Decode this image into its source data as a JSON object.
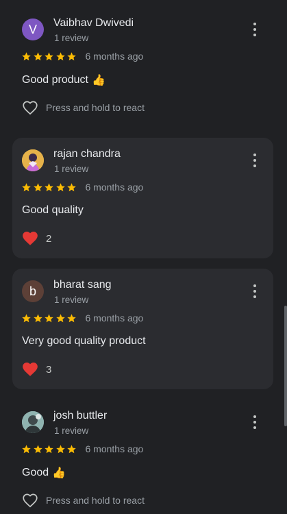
{
  "reviews": [
    {
      "reviewer": "Vaibhav Dwivedi",
      "avatar_letter": "V",
      "avatar_color": "#7e57c2",
      "review_count": "1 review",
      "rating": 5,
      "time": "6 months ago",
      "text": "Good product",
      "emoji": "👍",
      "reaction": "Press and hold to react",
      "liked": false
    },
    {
      "reviewer": "rajan chandra",
      "avatar_color": "#e6b24a",
      "review_count": "1 review",
      "rating": 5,
      "time": "6 months ago",
      "text": "Good quality",
      "emoji": "",
      "reaction_count": "2",
      "liked": true
    },
    {
      "reviewer": "bharat sang",
      "avatar_letter": "b",
      "avatar_color": "#5d4037",
      "review_count": "1 review",
      "rating": 5,
      "time": "6 months ago",
      "text": "Very good quality product",
      "emoji": "",
      "reaction_count": "3",
      "liked": true
    },
    {
      "reviewer": "josh buttler",
      "avatar_color": "#8fb3b0",
      "review_count": "1 review",
      "rating": 5,
      "time": "6 months ago",
      "text": "Good",
      "emoji": "👍",
      "reaction": "Press and hold to react",
      "liked": false
    }
  ],
  "colors": {
    "background": "#202124",
    "card": "#2b2c30",
    "star": "#fbbc04",
    "heart": "#e53935"
  }
}
